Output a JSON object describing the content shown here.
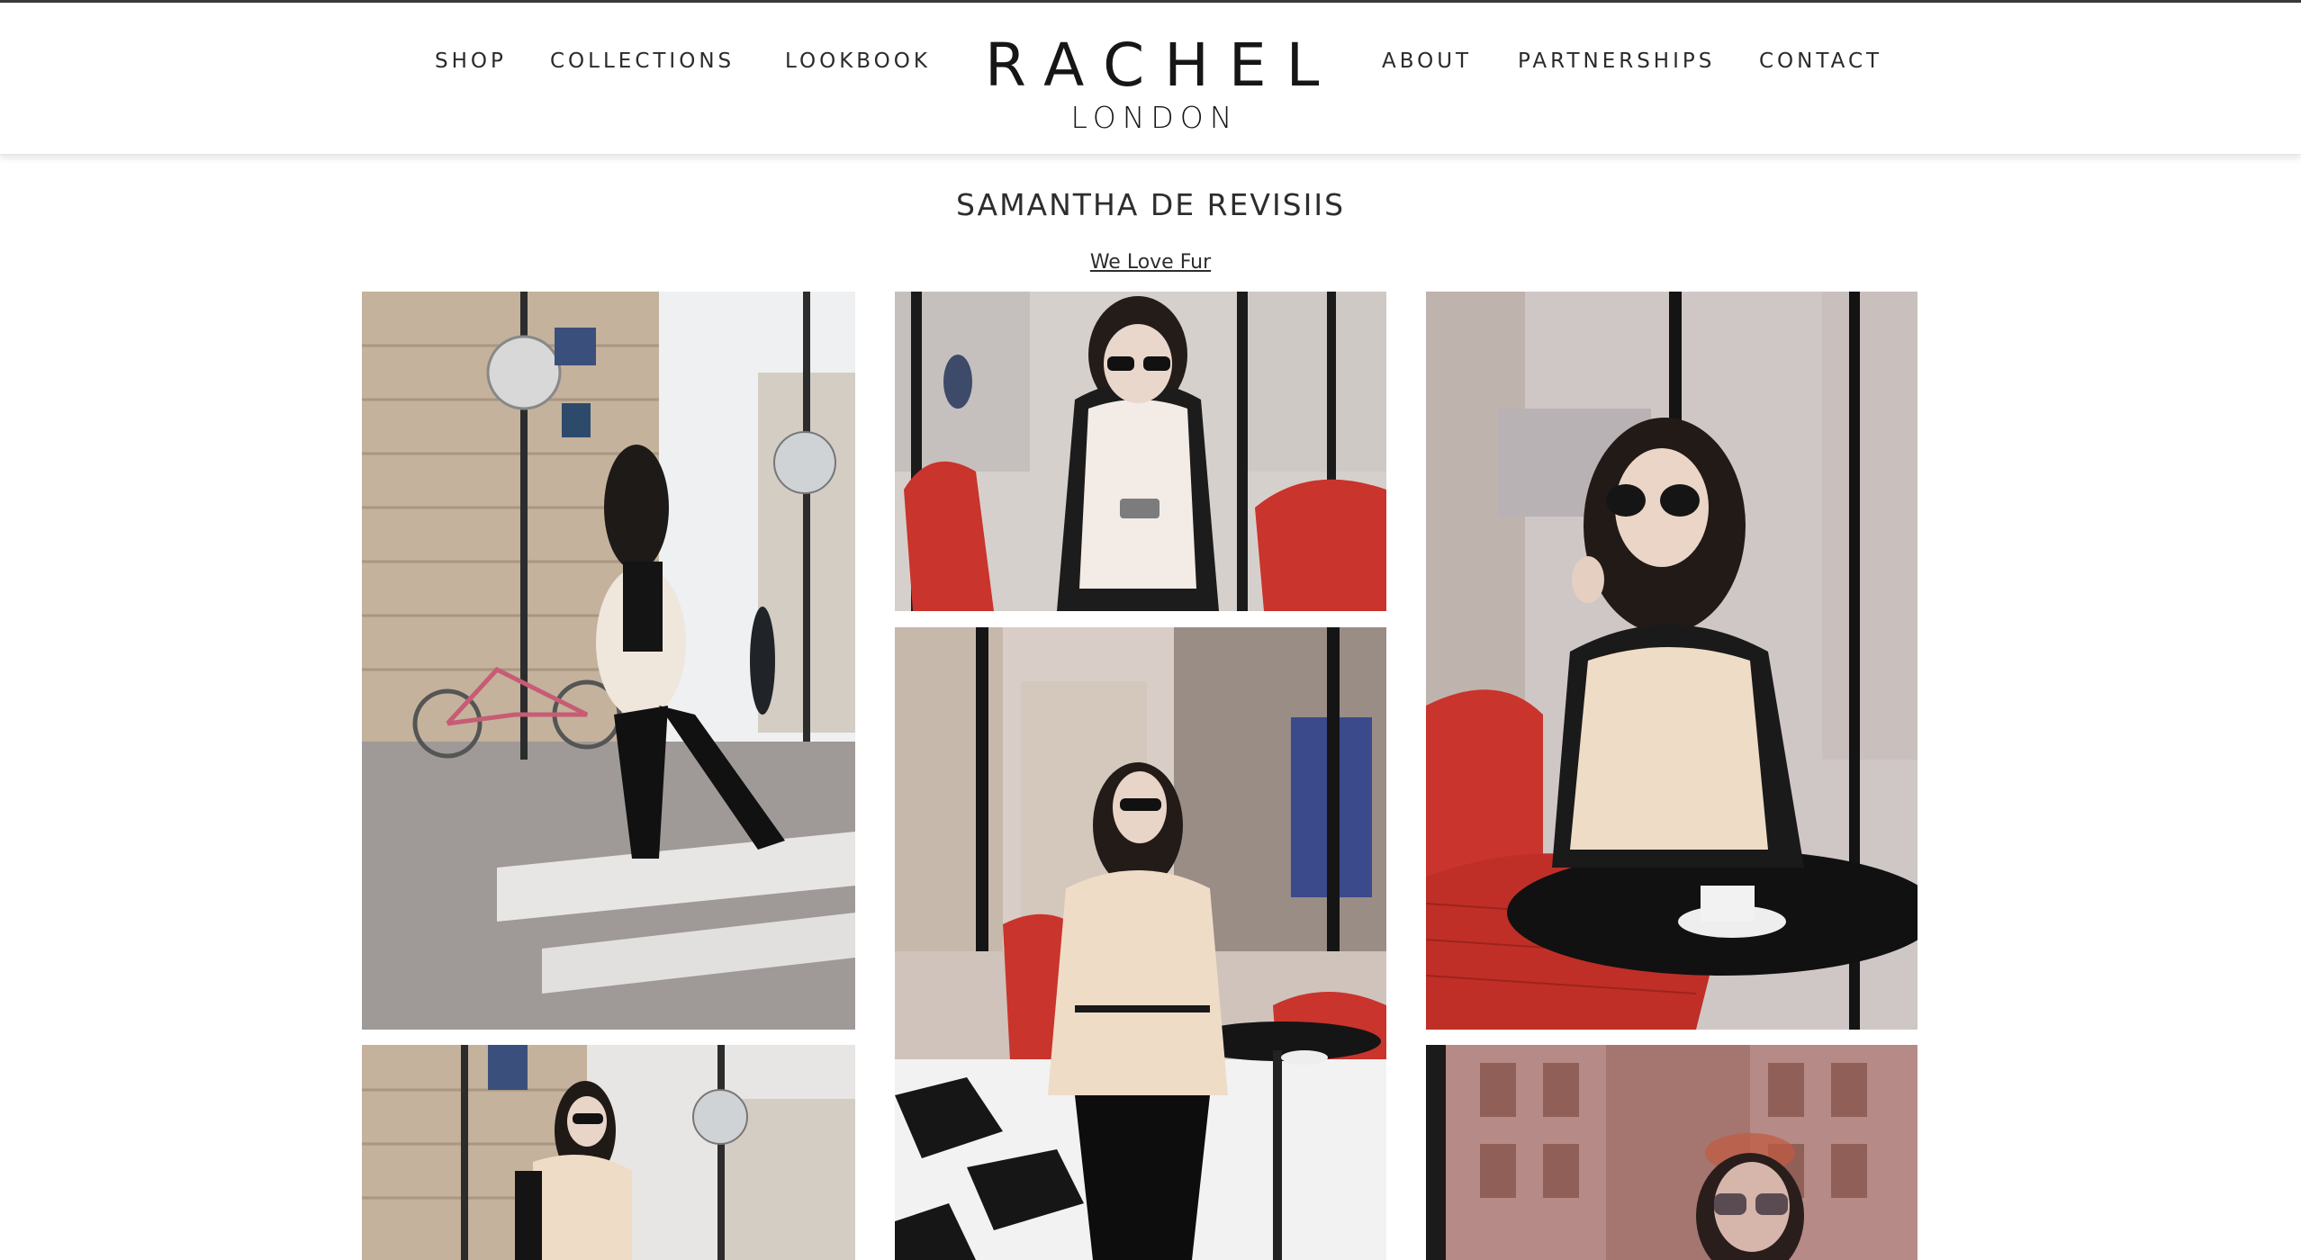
{
  "nav": {
    "left": [
      "SHOP",
      "COLLECTIONS",
      "LOOKBOOK"
    ],
    "right": [
      "ABOUT",
      "PARTNERSHIPS",
      "CONTACT"
    ]
  },
  "logo": {
    "main": "RACHEL",
    "sub": "LONDON"
  },
  "page": {
    "title": "SAMANTHA DE REVISIIS",
    "subtitle_link": "We Love Fur"
  },
  "gallery": {
    "photos": [
      {
        "name": "photo-street-crossing",
        "subject": "woman in fur gilet crossing cobbled Paris street"
      },
      {
        "name": "photo-cafe-phone",
        "subject": "woman in sunglasses looking at phone at cafe"
      },
      {
        "name": "photo-cafe-coffee",
        "subject": "woman with sunglasses drinking coffee at cafe table"
      },
      {
        "name": "photo-cafe-seated",
        "subject": "woman seated on cafe chair on checkered floor"
      },
      {
        "name": "photo-street-sign",
        "subject": "woman standing under street sign"
      },
      {
        "name": "photo-window-reflection",
        "subject": "woman seen through cafe window reflection"
      }
    ]
  },
  "colors": {
    "text": "#2a2a2a",
    "cafe_red": "#c9342c",
    "stone": "#c8b8a6"
  }
}
